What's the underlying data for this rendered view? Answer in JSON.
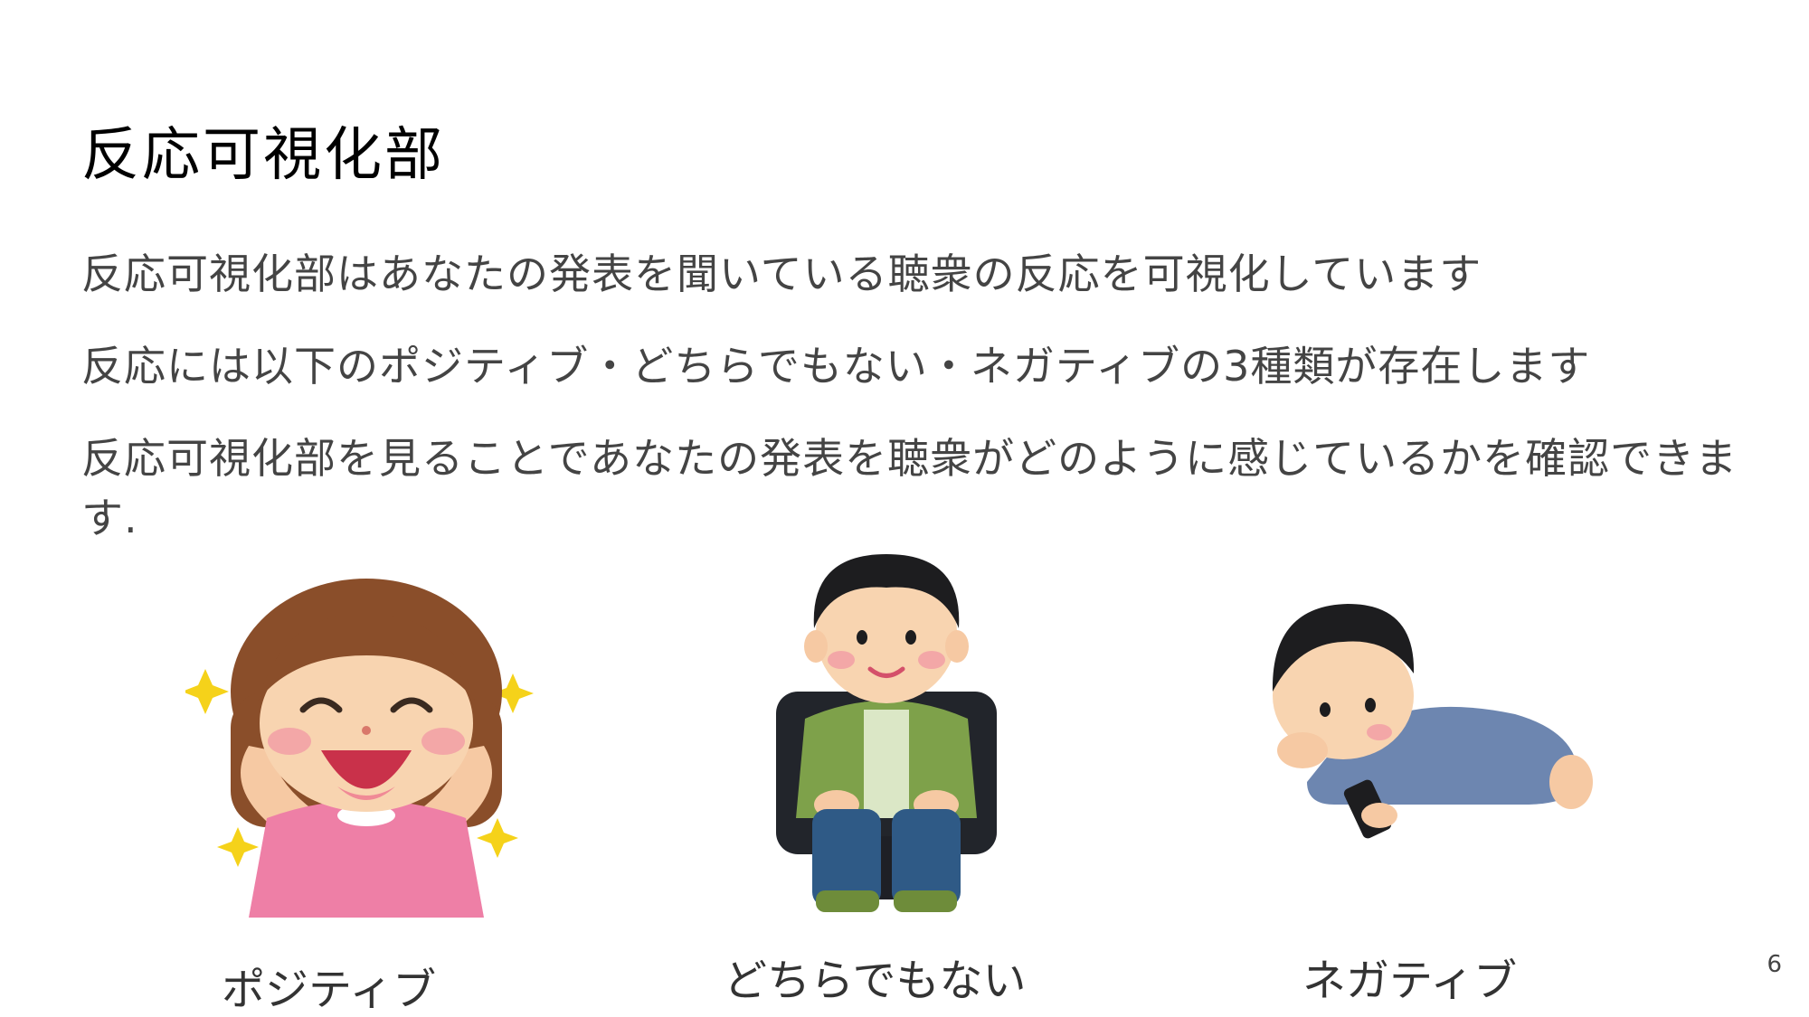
{
  "slide": {
    "title": "反応可視化部",
    "paragraphs": [
      "反応可視化部はあなたの発表を聞いている聴衆の反応を可視化しています",
      "反応には以下のポジティブ・どちらでもない・ネガティブの3種類が存在します",
      "反応可視化部を見ることであなたの発表を聴衆がどのように感じているかを確認できます."
    ],
    "reactions": [
      {
        "label": "ポジティブ",
        "icon": "happy-girl-icon"
      },
      {
        "label": "どちらでもない",
        "icon": "neutral-man-icon"
      },
      {
        "label": "ネガティブ",
        "icon": "bored-man-with-phone-icon"
      }
    ],
    "page_number": "6"
  },
  "colors": {
    "title": "#000000",
    "body_text": "#444444",
    "sparkle": "#f5d21a",
    "positive_shirt": "#ee7fa6",
    "neutral_jacket": "#7ea14a",
    "negative_clothes": "#6d86b0"
  }
}
